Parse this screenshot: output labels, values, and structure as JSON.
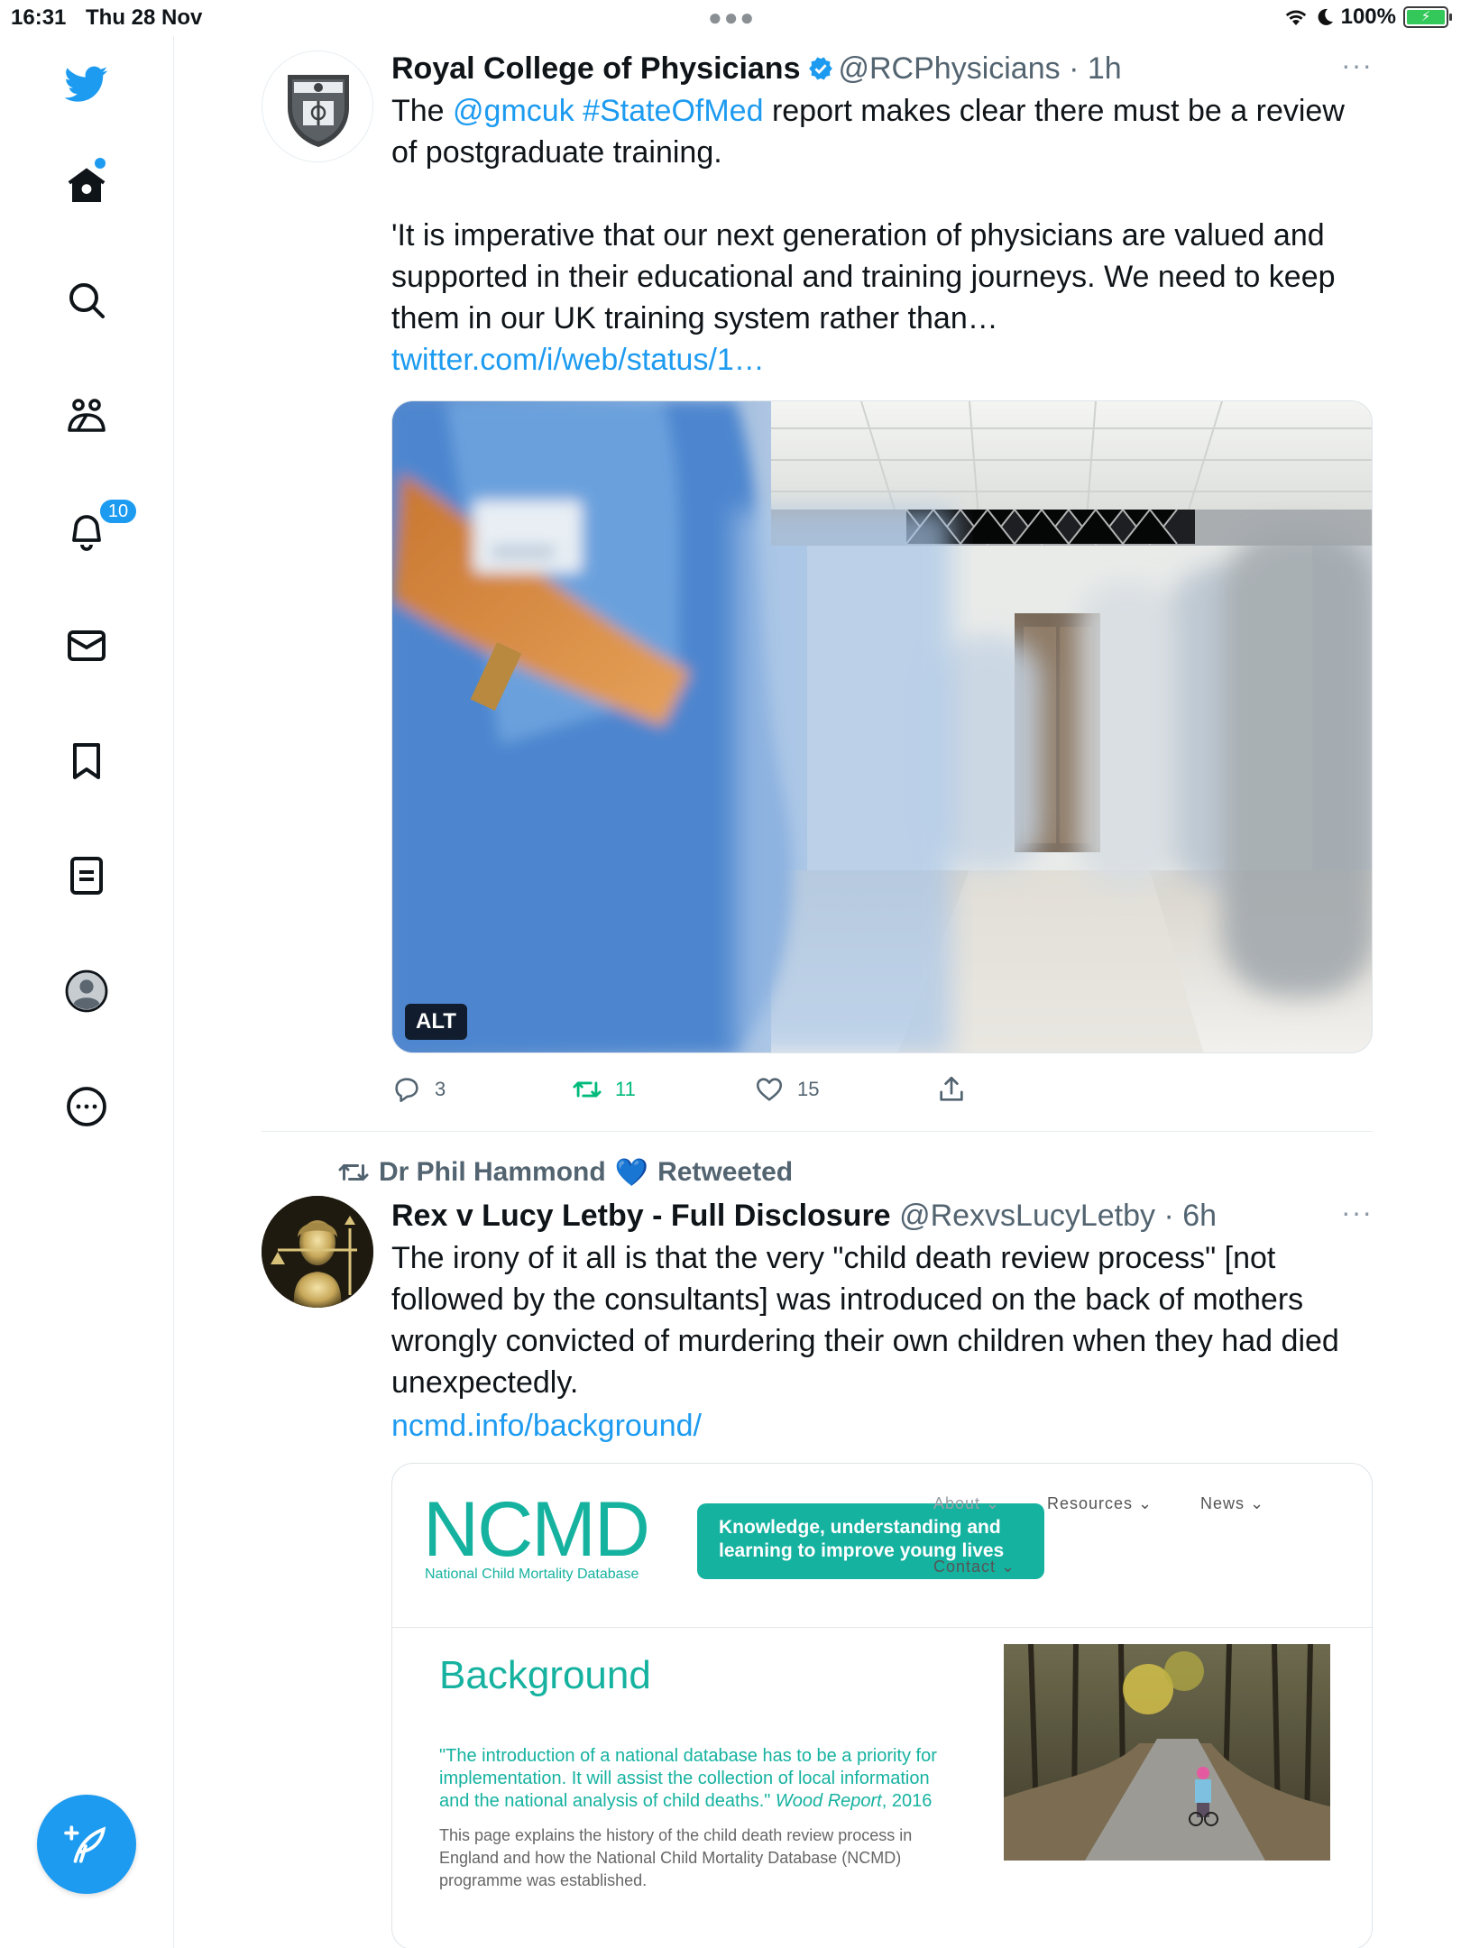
{
  "status_bar": {
    "time": "16:31",
    "date": "Thu 28 Nov",
    "battery": "100%"
  },
  "sidebar": {
    "notifications_count": "10"
  },
  "tweets": [
    {
      "name": "Royal College of Physicians",
      "handle": "@RCPhysicians",
      "time": "1h",
      "more": "···",
      "text": {
        "p1": "The ",
        "mention": "@gmcuk",
        "hashtag": "#StateOfMed",
        "p2": " report makes clear there must be a review of postgraduate training.",
        "p3": "'It is imperative that our next generation of physicians are valued and supported in their educational and training journeys. We need to keep them in our UK training system rather than… ",
        "link": "twitter.com/i/web/status/1…"
      },
      "media_alt_badge": "ALT",
      "replies": "3",
      "retweets": "11",
      "likes": "15"
    },
    {
      "retweeted_by": "Dr Phil Hammond",
      "retweeted_emoji": "💙",
      "retweeted_label": "Retweeted",
      "name": "Rex v Lucy Letby - Full Disclosure",
      "handle": "@RexvsLucyLetby",
      "time": "6h",
      "more": "···",
      "text": "The irony of it all is that the very \"child death review process\" [not followed by the consultants] was introduced on the back of mothers wrongly convicted of murdering their own children when they had died unexpectedly.",
      "link": "ncmd.info/background/",
      "card": {
        "logo": "NCMD",
        "logo_sub": "National Child Mortality Database",
        "tagline": "Knowledge, understanding and learning to improve young lives",
        "nav_about": "About ⌄",
        "nav_resources": "Resources ⌄",
        "nav_news": "News ⌄",
        "nav_contact": "Contact ⌄",
        "heading": "Background",
        "quote": "\"The introduction of a national database has to be a priority for implementation. It will assist the collection of local information and the national analysis of child deaths.\"",
        "quote_source": "Wood Report",
        "quote_year": ", 2016",
        "description": "This page explains the history of the child death review process in England and how the National Child Mortality Database (NCMD) programme was established."
      }
    }
  ],
  "colors": {
    "twitter_blue": "#1d9bf0",
    "ncmd_teal": "#16b2a0",
    "retweet_green": "#00ba7c"
  },
  "icons": [
    "twitter-logo-icon",
    "home-icon",
    "search-icon",
    "communities-icon",
    "bell-icon",
    "mail-icon",
    "bookmark-icon",
    "lists-icon",
    "profile-icon",
    "more-circle-icon",
    "compose-icon",
    "reply-icon",
    "retweet-icon",
    "heart-icon",
    "share-icon",
    "verified-badge-icon"
  ]
}
